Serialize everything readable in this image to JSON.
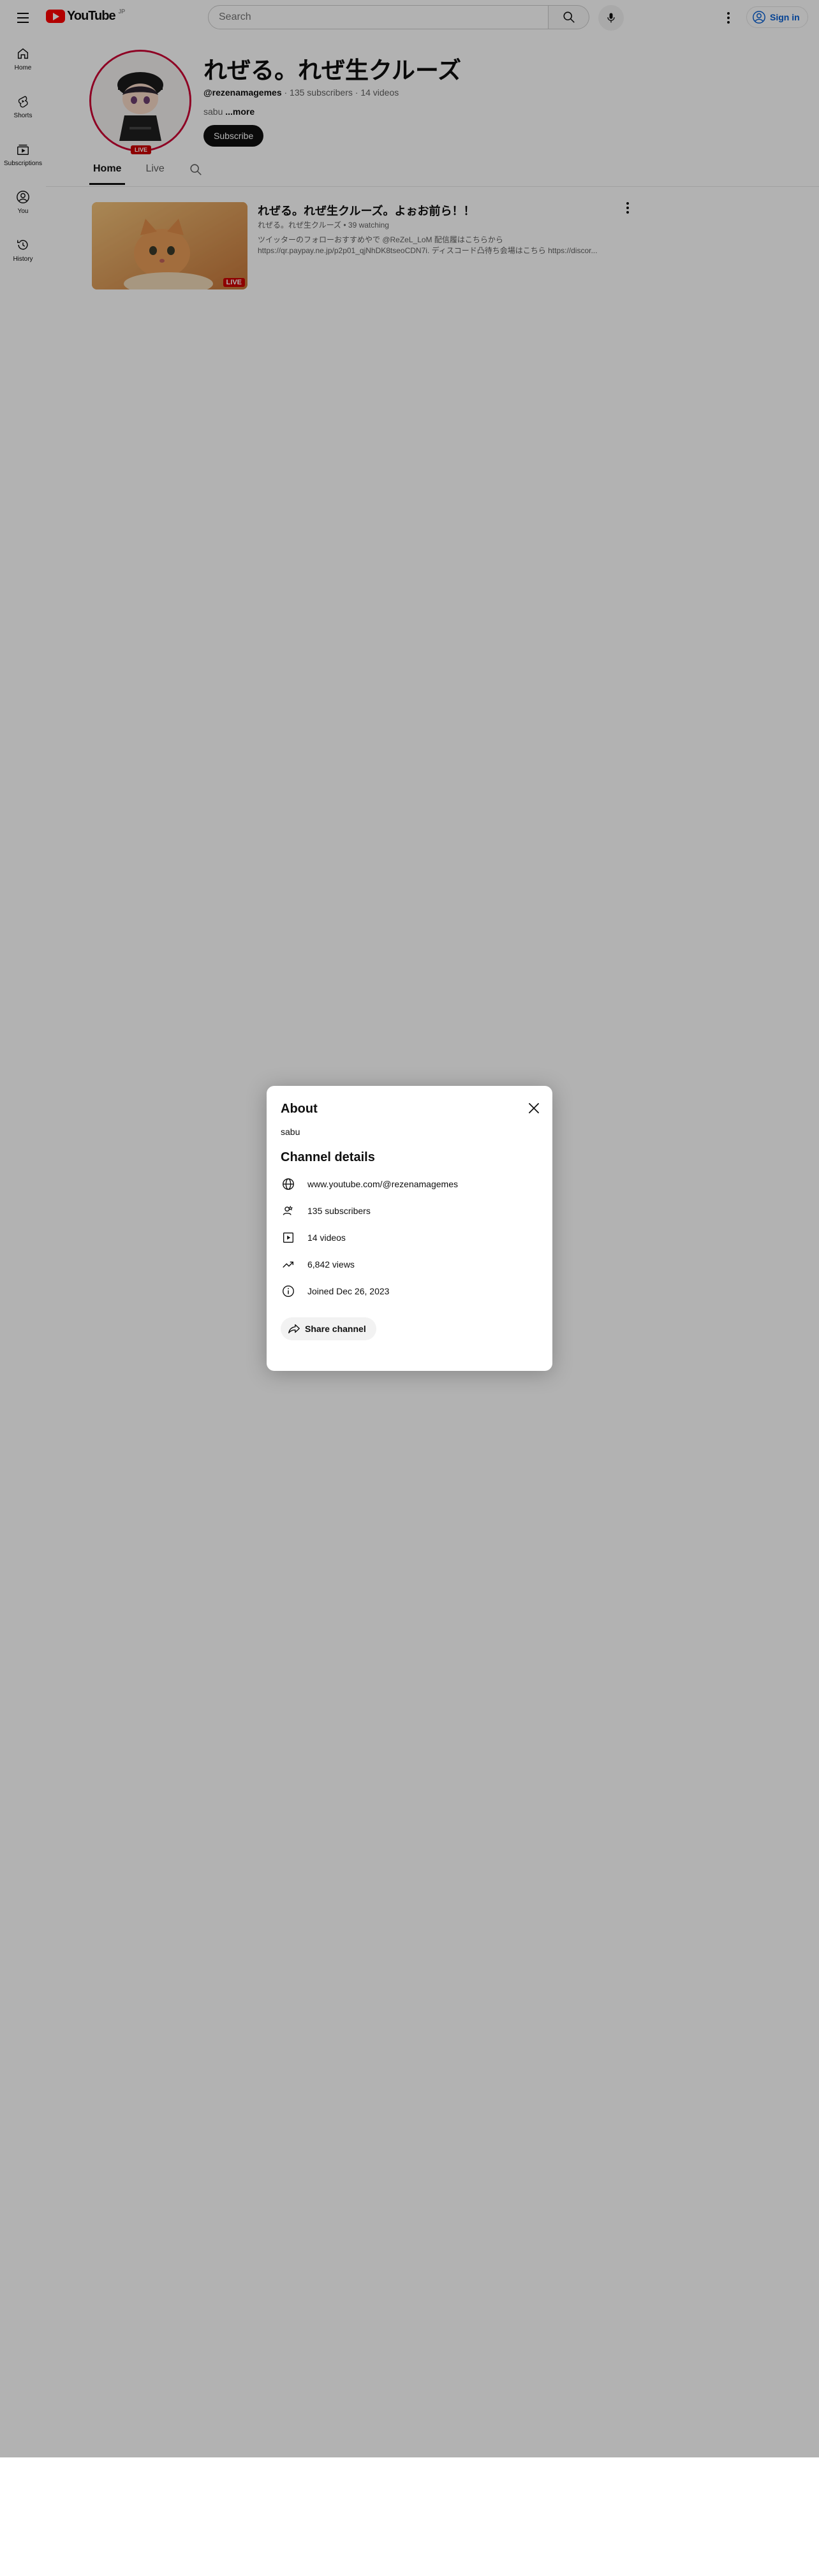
{
  "header": {
    "logo_text": "YouTube",
    "logo_country": "JP",
    "search_placeholder": "Search",
    "signin_label": "Sign in"
  },
  "sidebar": {
    "items": [
      {
        "label": "Home",
        "icon": "home-icon"
      },
      {
        "label": "Shorts",
        "icon": "shorts-icon"
      },
      {
        "label": "Subscriptions",
        "icon": "subscriptions-icon"
      },
      {
        "label": "You",
        "icon": "you-icon"
      },
      {
        "label": "History",
        "icon": "history-icon"
      }
    ]
  },
  "channel": {
    "title": "れぜる。れぜ生クルーズ",
    "handle": "@rezenamagemes",
    "stats": "· 135 subscribers · 14 videos",
    "description": "sabu",
    "more_label": "...more",
    "subscribe_label": "Subscribe",
    "live_badge": "LIVE",
    "tabs": [
      "Home",
      "Live"
    ]
  },
  "video": {
    "title": "れぜる。れぜ生クルーズ。よぉお前ら！！",
    "meta": "れぜる。れぜ生クルーズ • 39 watching",
    "desc_line1": "ツイッターのフォローおすすめやで @ReZeL_LoM 配信履はこちらから",
    "desc_line2": "https://qr.paypay.ne.jp/p2p01_qjNhDK8tseoCDN7i. ディスコード凸待ち会場はこちら https://discor...",
    "live_badge": "LIVE"
  },
  "about_dialog": {
    "title": "About",
    "description": "sabu",
    "section_title": "Channel details",
    "rows": [
      {
        "icon": "globe-icon",
        "text": "www.youtube.com/@rezenamagemes"
      },
      {
        "icon": "subscribers-icon",
        "text": "135 subscribers"
      },
      {
        "icon": "video-icon",
        "text": "14 videos"
      },
      {
        "icon": "trending-icon",
        "text": "6,842 views"
      },
      {
        "icon": "info-icon",
        "text": "Joined Dec 26, 2023"
      }
    ],
    "share_label": "Share channel"
  },
  "colors": {
    "accent_red": "#ff0000",
    "live_red": "#cc0000",
    "link_blue": "#065fd4",
    "avatar_ring": "#cc0033"
  }
}
